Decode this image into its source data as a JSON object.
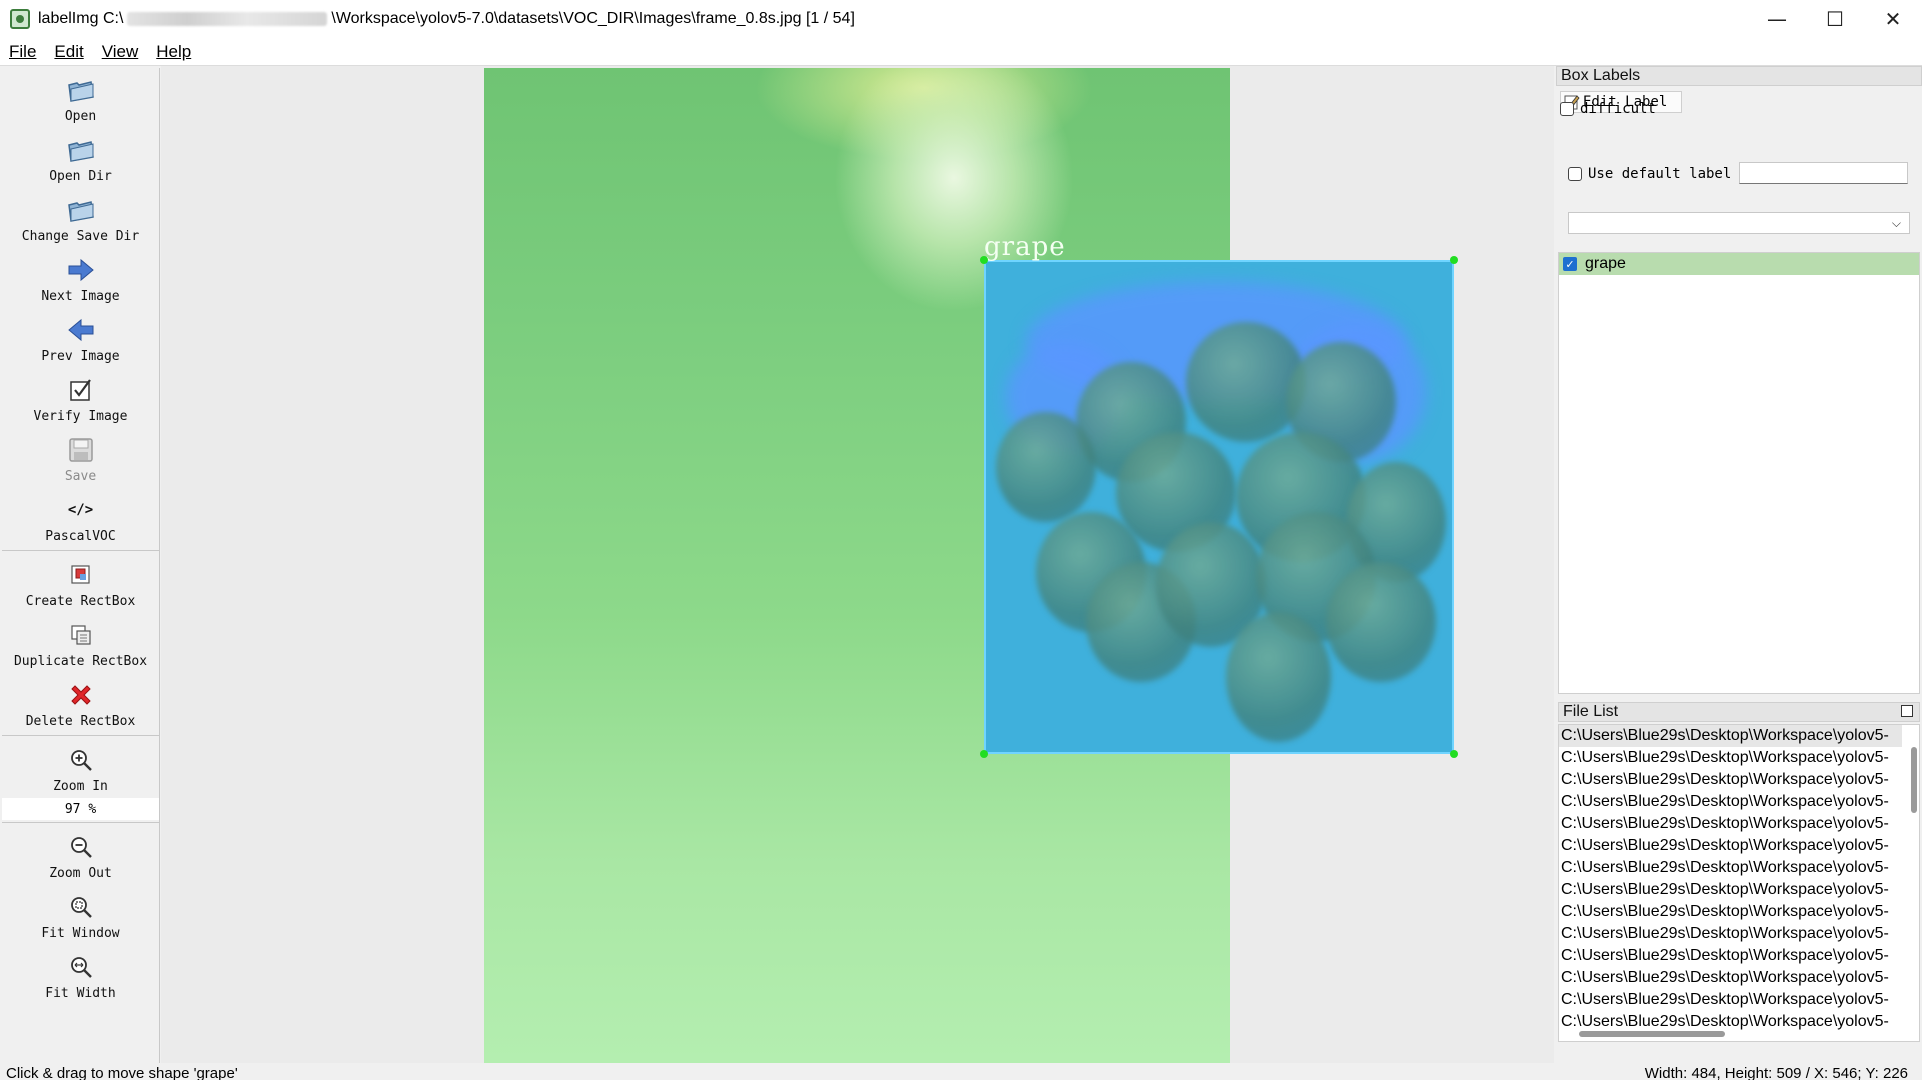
{
  "window": {
    "app_name": "labelImg",
    "title_prefix": "C:\\",
    "title_suffix": "\\Workspace\\yolov5-7.0\\datasets\\VOC_DIR\\Images\\frame_0.8s.jpg [1 / 54]",
    "minimize": "—",
    "maximize": "☐",
    "close": "✕"
  },
  "menu": [
    "File",
    "Edit",
    "View",
    "Help"
  ],
  "toolbar": {
    "open": "Open",
    "open_dir": "Open Dir",
    "change_save_dir": "Change Save Dir",
    "next_image": "Next Image",
    "prev_image": "Prev Image",
    "verify_image": "Verify Image",
    "save": "Save",
    "format_icon": "</>",
    "format": "PascalVOC",
    "create_rectbox": "Create RectBox",
    "duplicate_rectbox": "Duplicate RectBox",
    "delete_rectbox": "Delete RectBox",
    "zoom_in": "Zoom In",
    "zoom_value": "97 %",
    "zoom_out": "Zoom Out",
    "fit_window": "Fit Window",
    "fit_width": "Fit Width"
  },
  "canvas": {
    "box_label": "grape"
  },
  "box_labels_panel": {
    "title": "Box Labels",
    "edit_label": "Edit Label",
    "difficult": "difficult",
    "use_default_label": "Use default label",
    "default_label_value": "",
    "combo_value": "",
    "labels": [
      {
        "name": "grape",
        "checked": true
      }
    ]
  },
  "file_list_panel": {
    "title": "File List",
    "files": [
      "C:\\Users\\Blue29s\\Desktop\\Workspace\\yolov5-",
      "C:\\Users\\Blue29s\\Desktop\\Workspace\\yolov5-",
      "C:\\Users\\Blue29s\\Desktop\\Workspace\\yolov5-",
      "C:\\Users\\Blue29s\\Desktop\\Workspace\\yolov5-",
      "C:\\Users\\Blue29s\\Desktop\\Workspace\\yolov5-",
      "C:\\Users\\Blue29s\\Desktop\\Workspace\\yolov5-",
      "C:\\Users\\Blue29s\\Desktop\\Workspace\\yolov5-",
      "C:\\Users\\Blue29s\\Desktop\\Workspace\\yolov5-",
      "C:\\Users\\Blue29s\\Desktop\\Workspace\\yolov5-",
      "C:\\Users\\Blue29s\\Desktop\\Workspace\\yolov5-",
      "C:\\Users\\Blue29s\\Desktop\\Workspace\\yolov5-",
      "C:\\Users\\Blue29s\\Desktop\\Workspace\\yolov5-",
      "C:\\Users\\Blue29s\\Desktop\\Workspace\\yolov5-",
      "C:\\Users\\Blue29s\\Desktop\\Workspace\\yolov5-"
    ]
  },
  "status": {
    "left": "Click & drag to move shape 'grape'",
    "right": "Width: 484, Height: 509 / X: 546; Y: 226"
  },
  "colors": {
    "bbox_fill": "#3fb0dc",
    "handle": "#22dd22",
    "selected_label_bg": "#b8dcae"
  }
}
